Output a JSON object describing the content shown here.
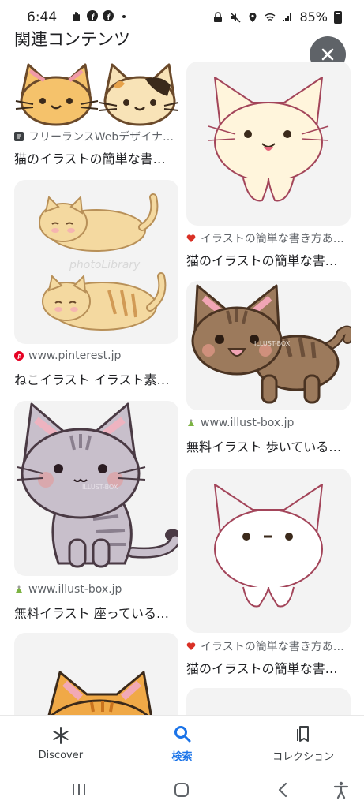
{
  "status_bar": {
    "time": "6:44",
    "battery": "85%"
  },
  "header": {
    "title": "関連コンテンツ"
  },
  "results": [
    {
      "source": "フリーランスWebデザイナ…",
      "title": "猫のイラストの簡単な書…",
      "image": "two-cat-faces"
    },
    {
      "source": "イラストの簡単な書き方あ…",
      "title": "猫のイラストの簡単な書…",
      "image": "cream-cat"
    },
    {
      "source": "www.pinterest.jp",
      "title": "ねこイラスト イラスト素…",
      "image": "sleeping-cats",
      "watermark": "photoLibrary"
    },
    {
      "source": "www.illust-box.jp",
      "title": "無料イラスト 歩いている…",
      "image": "brown-cat-walking",
      "watermark": "ILLUST-BOX"
    },
    {
      "source": "www.illust-box.jp",
      "title": "無料イラスト 座っている…",
      "image": "gray-cat-sitting",
      "watermark": "ILLUST-BOX"
    },
    {
      "source": "イラストの簡単な書き方あ…",
      "title": "猫のイラストの簡単な書…",
      "image": "outline-cat"
    }
  ],
  "bottom_nav": [
    {
      "label": "Discover",
      "icon": "asterisk-icon"
    },
    {
      "label": "検索",
      "icon": "search-icon",
      "active": true
    },
    {
      "label": "コレクション",
      "icon": "collections-icon"
    }
  ],
  "colors": {
    "accent": "#1a73e8",
    "thumb_bg": "#f3f3f3",
    "close_bg": "#5f6368"
  }
}
